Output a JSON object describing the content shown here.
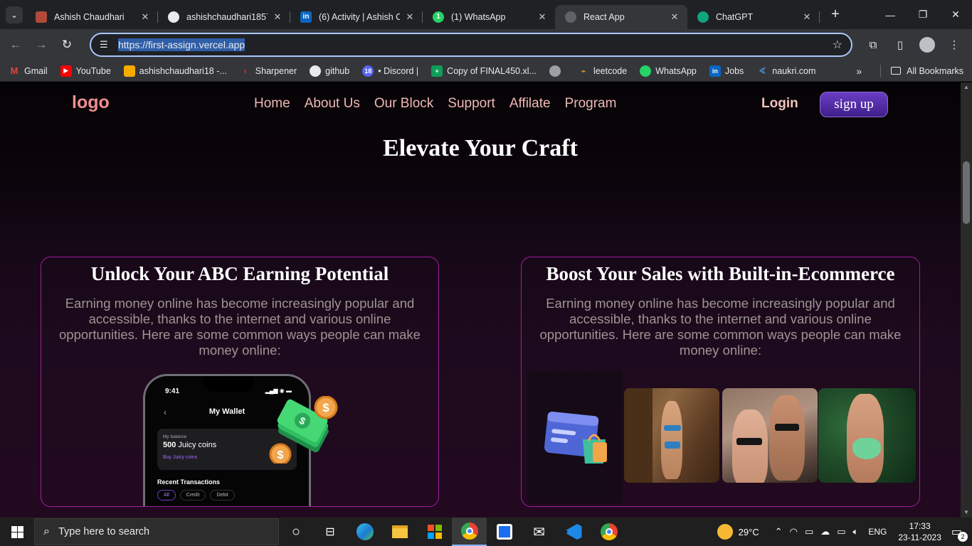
{
  "browser": {
    "tabs": [
      {
        "title": "Ashish Chaudhari",
        "favicon": "profile",
        "active": false
      },
      {
        "title": "ashishchaudhari1857/",
        "favicon": "github",
        "active": false
      },
      {
        "title": "(6) Activity | Ashish Ch",
        "favicon": "linkedin",
        "active": false
      },
      {
        "title": "(1) WhatsApp",
        "favicon": "whatsapp",
        "active": false
      },
      {
        "title": "React App",
        "favicon": "globe",
        "active": true
      },
      {
        "title": "ChatGPT",
        "favicon": "chatgpt",
        "active": false
      }
    ],
    "url": "https://first-assign.vercel.app",
    "bookmarks": [
      {
        "label": "Gmail",
        "icon": "gmail",
        "color": "#ea4335"
      },
      {
        "label": "YouTube",
        "icon": "youtube",
        "color": "#ff0000"
      },
      {
        "label": "ashishchaudhari18 -...",
        "icon": "analytics",
        "color": "#f9ab00"
      },
      {
        "label": "Sharpener",
        "icon": "sharpener",
        "color": "#d93025"
      },
      {
        "label": "github",
        "icon": "github",
        "color": "#e8eaed"
      },
      {
        "label": "• Discord |",
        "icon": "discord",
        "color": "#5865f2"
      },
      {
        "label": "Copy of FINAL450.xl...",
        "icon": "sheets",
        "color": "#0f9d58"
      },
      {
        "label": "",
        "icon": "globe",
        "color": "#9aa0a6"
      },
      {
        "label": "leetcode",
        "icon": "leetcode",
        "color": "#ffa116"
      },
      {
        "label": "WhatsApp",
        "icon": "whatsapp",
        "color": "#25d366"
      },
      {
        "label": "Jobs",
        "icon": "linkedin",
        "color": "#0a66c2"
      },
      {
        "label": "naukri.com",
        "icon": "naukri",
        "color": "#4a90e2"
      }
    ],
    "all_bookmarks": "All Bookmarks"
  },
  "site": {
    "logo": "logo",
    "nav": [
      "Home",
      "About Us",
      "Our Block",
      "Support",
      "Affilate",
      "Program"
    ],
    "login": "Login",
    "signup": "sign up",
    "hero_title": "Elevate Your Craft",
    "cards": [
      {
        "title": "Unlock Your ABC Earning Potential",
        "body": "Earning money online has become increasingly popular and accessible, thanks to the internet and various online opportunities. Here are some common ways people can make money online:"
      },
      {
        "title": "Boost Your Sales with Built-in-Ecommerce",
        "body": "Earning money online has become increasingly popular and accessible, thanks to the internet and various online opportunities. Here are some common ways people can make money online:"
      }
    ],
    "phone": {
      "time": "9:41",
      "title": "My Wallet",
      "balance_label": "My balance",
      "balance_amount": "500",
      "balance_unit": " Juicy coins",
      "buy_link": "Buy Juicy coins",
      "recent": "Recent Transactions",
      "filters": [
        "All",
        "Credit",
        "Debit"
      ]
    }
  },
  "taskbar": {
    "search_placeholder": "Type here to search",
    "weather": "29°C",
    "language": "ENG",
    "time": "17:33",
    "date": "23-11-2023",
    "notifications": "2"
  }
}
